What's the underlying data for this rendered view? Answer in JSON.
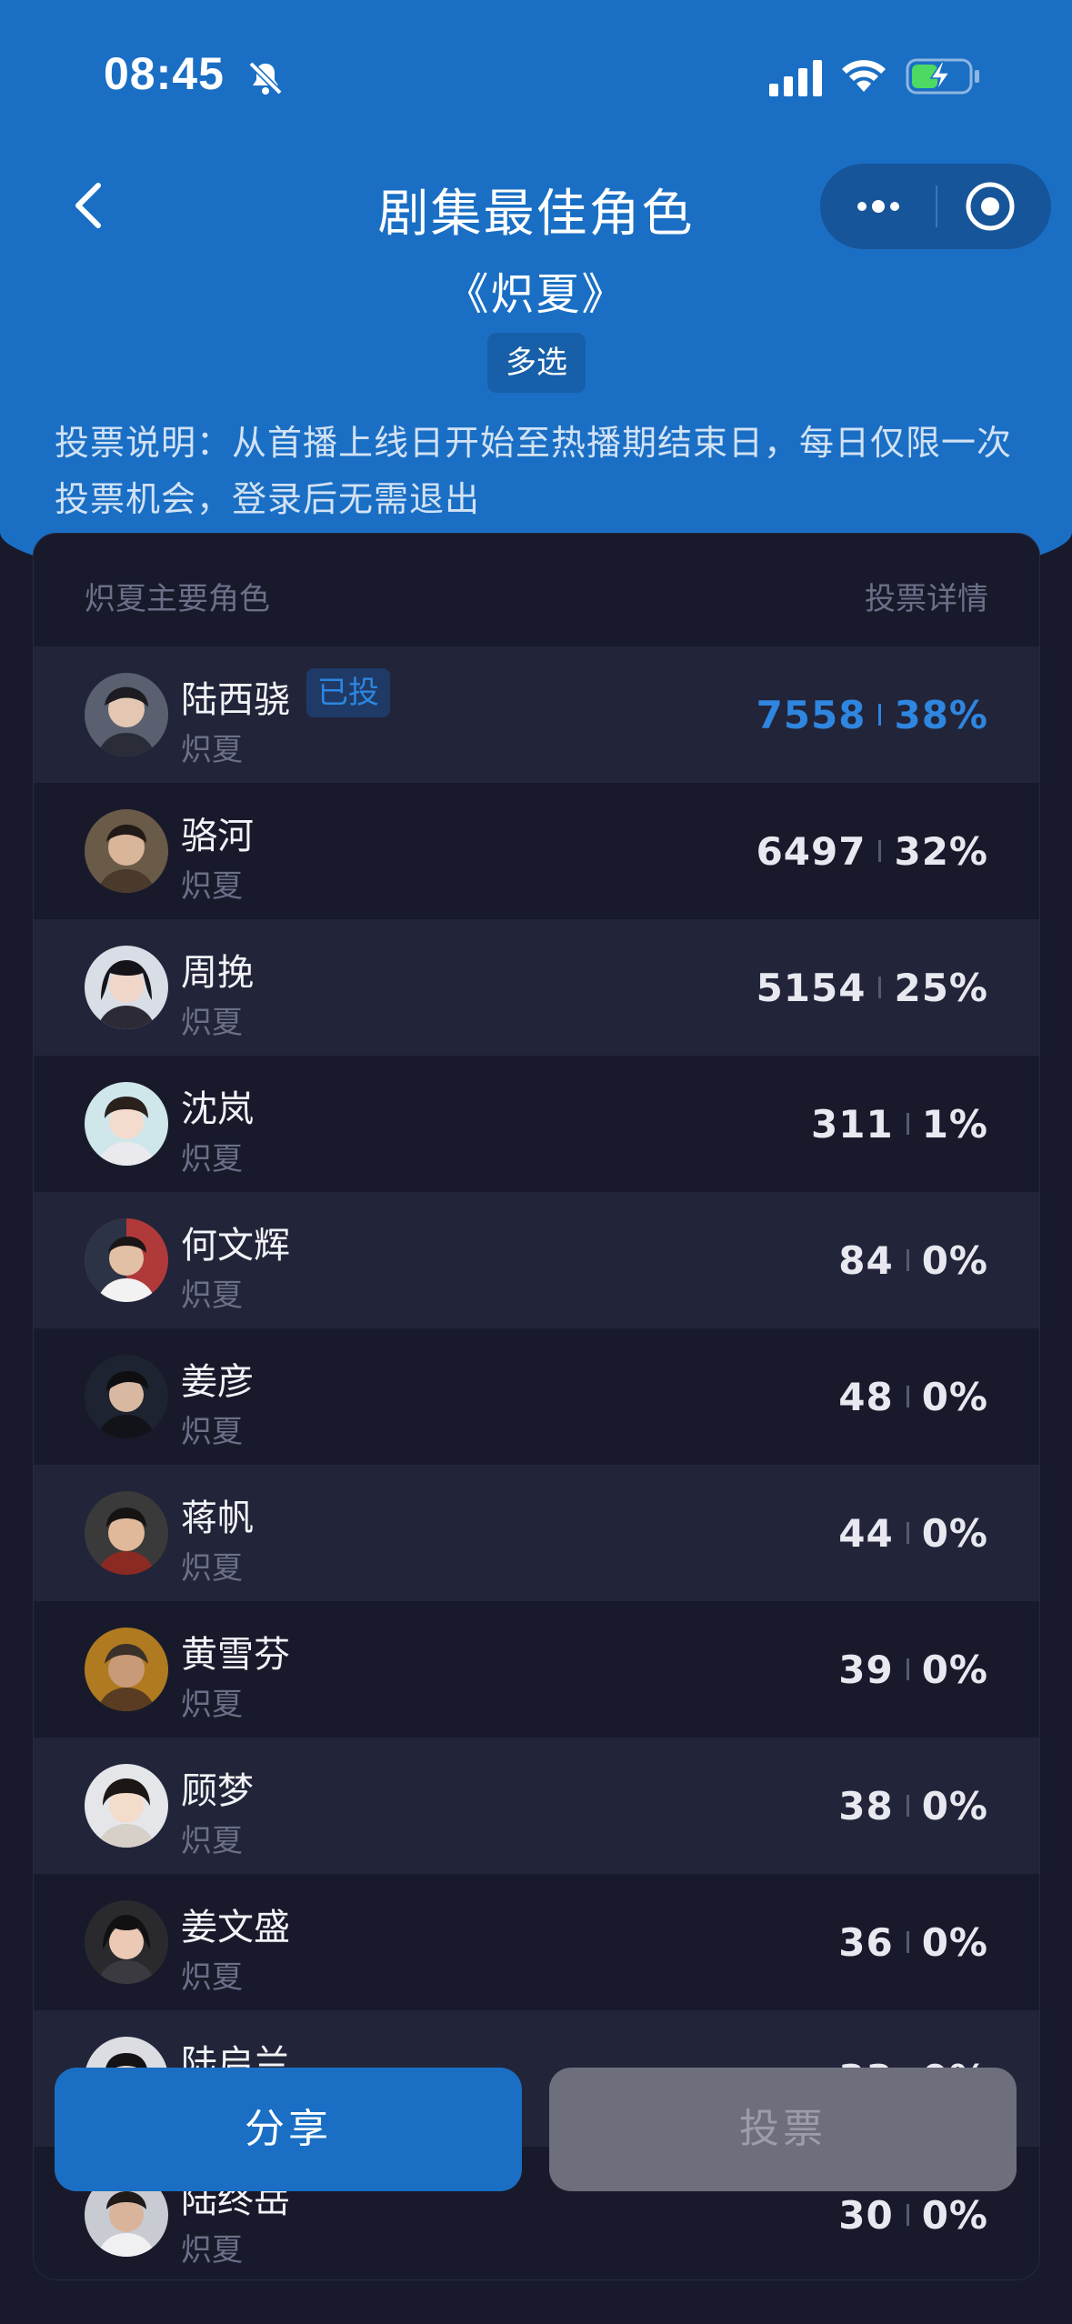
{
  "status_bar": {
    "time": "08:45"
  },
  "nav": {
    "title": "剧集最佳角色"
  },
  "header": {
    "subtitle": "《炽夏》",
    "tag": "多选",
    "description": "投票说明：从首播上线日开始至热播期结束日，每日仅限一次投票机会，登录后无需退出"
  },
  "card": {
    "left_header": "炽夏主要角色",
    "right_header": "投票详情",
    "voted_badge": "已投",
    "rows": [
      {
        "name": "陆西骁",
        "show": "炽夏",
        "votes": "7558",
        "percent": "38%"
      },
      {
        "name": "骆河",
        "show": "炽夏",
        "votes": "6497",
        "percent": "32%"
      },
      {
        "name": "周挽",
        "show": "炽夏",
        "votes": "5154",
        "percent": "25%"
      },
      {
        "name": "沈岚",
        "show": "炽夏",
        "votes": "311",
        "percent": "1%"
      },
      {
        "name": "何文辉",
        "show": "炽夏",
        "votes": "84",
        "percent": "0%"
      },
      {
        "name": "姜彦",
        "show": "炽夏",
        "votes": "48",
        "percent": "0%"
      },
      {
        "name": "蒋帆",
        "show": "炽夏",
        "votes": "44",
        "percent": "0%"
      },
      {
        "name": "黄雪芬",
        "show": "炽夏",
        "votes": "39",
        "percent": "0%"
      },
      {
        "name": "顾梦",
        "show": "炽夏",
        "votes": "38",
        "percent": "0%"
      },
      {
        "name": "姜文盛",
        "show": "炽夏",
        "votes": "36",
        "percent": "0%"
      },
      {
        "name": "陆启兰",
        "show": "炽夏",
        "votes": "33",
        "percent": "0%"
      },
      {
        "name": "陆终岳",
        "show": "炽夏",
        "votes": "30",
        "percent": "0%"
      }
    ]
  },
  "buttons": {
    "share": "分享",
    "vote": "投票"
  },
  "colors": {
    "primary": "#1a6fc4",
    "background": "#181a2b",
    "row_alt": "#222439",
    "highlight": "#2e86e0"
  }
}
